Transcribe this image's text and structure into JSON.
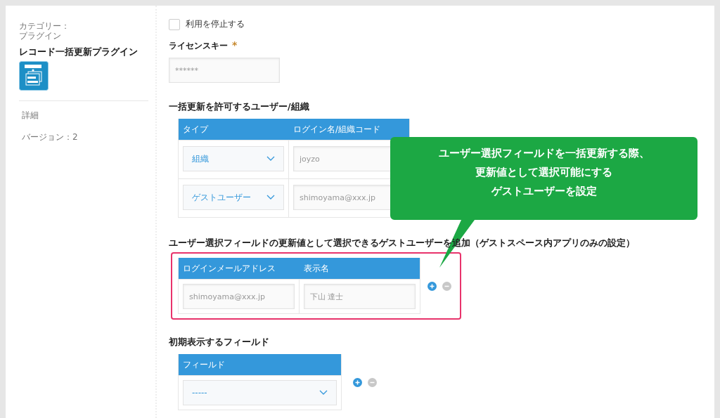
{
  "sidebar": {
    "category_label": "カテゴリー：",
    "category": "プラグイン",
    "plugin_name": "レコード一括更新プラグイン",
    "items": [
      {
        "label": "詳細"
      },
      {
        "label": "バージョン：2"
      }
    ]
  },
  "disable": {
    "label": "利用を停止する",
    "checked": false
  },
  "license": {
    "label": "ライセンスキー",
    "required_mark": "*",
    "value": "******"
  },
  "sections": [
    {
      "title": "一括更新を許可するユーザー/組織",
      "highlighted": false,
      "columns": [
        {
          "label": "タイプ",
          "kind": "select"
        },
        {
          "label": "ログイン名/組織コード",
          "kind": "text"
        }
      ],
      "rows": [
        [
          "組織",
          "joyzo"
        ],
        [
          "ゲストユーザー",
          "shimoyama@xxx.jp"
        ]
      ],
      "add_remove": false
    },
    {
      "title": "ユーザー選択フィールドの更新値として選択できるゲストユーザーを追加（ゲストスペース内アプリのみの設定）",
      "highlighted": true,
      "columns": [
        {
          "label": "ログインメールアドレス",
          "kind": "text"
        },
        {
          "label": "表示名",
          "kind": "text"
        }
      ],
      "rows": [
        [
          "shimoyama@xxx.jp",
          "下山 達士"
        ]
      ],
      "add_remove": true
    },
    {
      "title": "初期表示するフィールド",
      "highlighted": false,
      "columns": [
        {
          "label": "フィールド",
          "kind": "select"
        }
      ],
      "rows": [
        [
          "-----"
        ]
      ],
      "add_remove": true
    }
  ],
  "callout": {
    "lines": [
      "ユーザー選択フィールドを一括更新する際、",
      "更新値として選択可能にする",
      "ゲストユーザーを設定"
    ]
  }
}
